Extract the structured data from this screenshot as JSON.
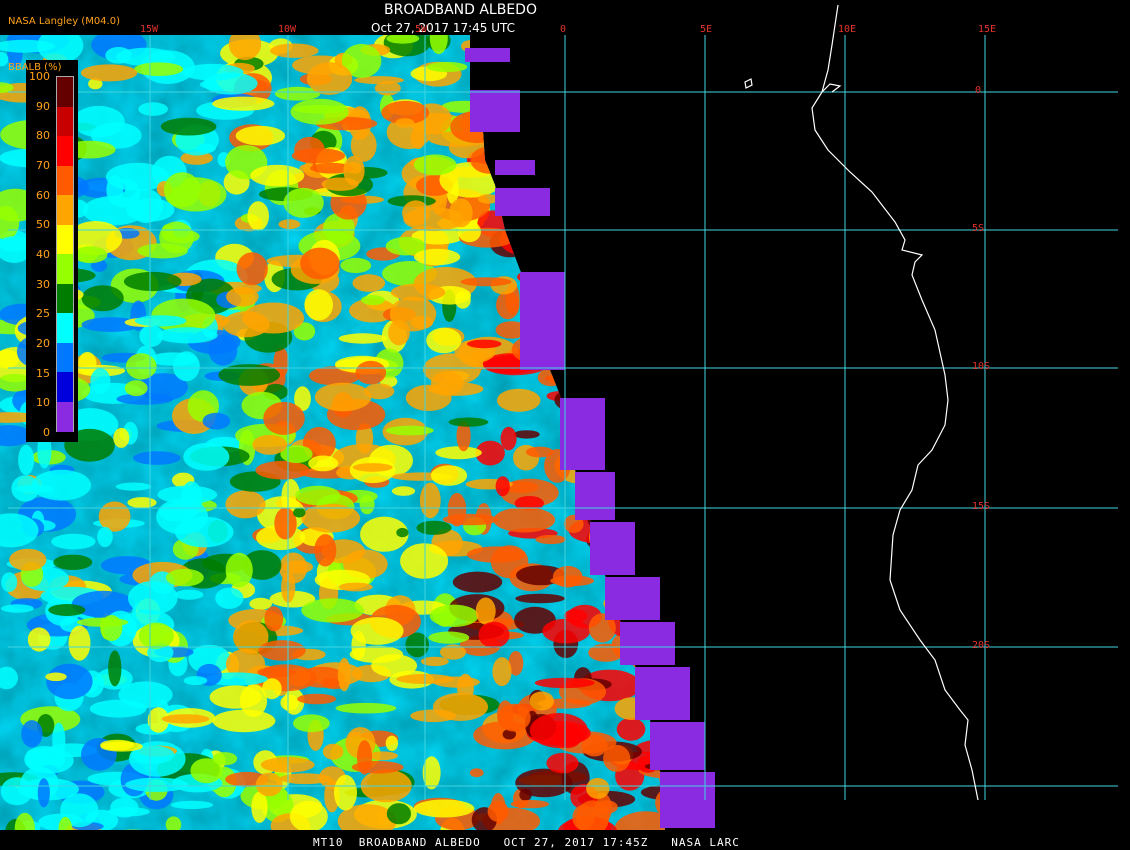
{
  "header": {
    "title": "BROADBAND ALBEDO",
    "subtitle": "Oct 27, 2017 17:45 UTC",
    "credit": "NASA Langley (M04.0)"
  },
  "footer": {
    "text": "MT10  BROADBAND ALBEDO   OCT 27, 2017 17:45Z   NASA LARC"
  },
  "legend": {
    "title": "BBALB (%)",
    "labels": [
      "100",
      "90",
      "80",
      "70",
      "60",
      "50",
      "40",
      "30",
      "25",
      "20",
      "15",
      "10",
      "0"
    ],
    "colors": [
      "#640000",
      "#c80000",
      "#ff0000",
      "#ff5a00",
      "#ffa500",
      "#ffff00",
      "#96ff00",
      "#007d00",
      "#00ffff",
      "#0078ff",
      "#0000dc",
      "#8a2be2"
    ]
  },
  "grid": {
    "lon_labels": [
      "15W",
      "10W",
      "5W",
      "0",
      "5E",
      "10E",
      "15E"
    ],
    "lat_labels": [
      "0",
      "5S",
      "10S",
      "15S",
      "20S"
    ],
    "color": "#3fd5e0"
  },
  "colors": {
    "background": "#000000",
    "coastline": "#ffffff",
    "no_data": "#8a2be2"
  }
}
